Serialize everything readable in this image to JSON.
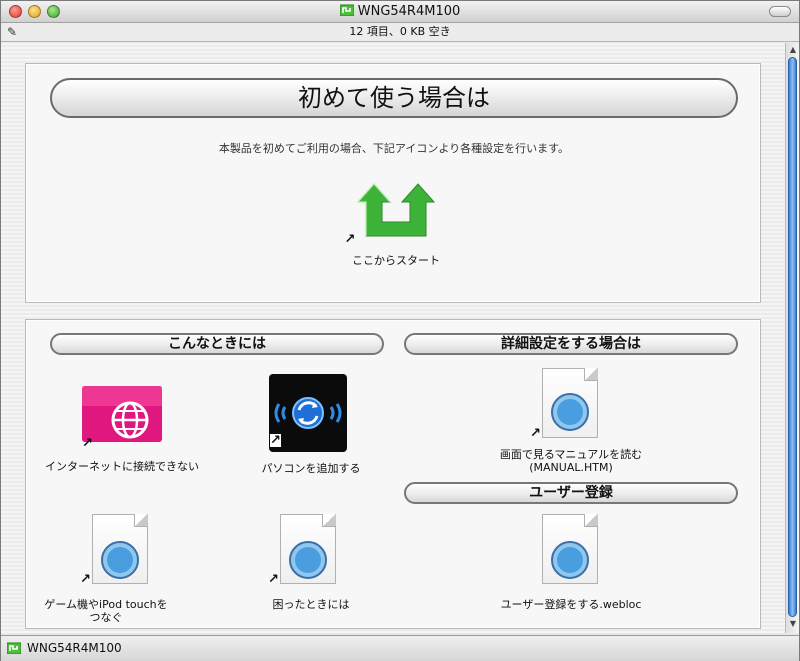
{
  "window": {
    "title": "WNG54R4M100",
    "status": "12 項目、0 KB 空き"
  },
  "top_panel": {
    "heading": "初めて使う場合は",
    "description": "本製品を初めてご利用の場合、下記アイコンより各種設定を行います。",
    "start_item": {
      "label": "ここからスタート",
      "icon": "green-arrow-start-icon"
    }
  },
  "left_section": {
    "heading": "こんなときには",
    "items": [
      {
        "label": "インターネットに接続できない",
        "icon": "pink-globe-icon"
      },
      {
        "label": "パソコンを追加する",
        "icon": "blue-sync-icon"
      },
      {
        "label": "ゲーム機やiPod touchをつなぐ",
        "icon": "safari-document-icon"
      },
      {
        "label": "困ったときには",
        "icon": "safari-document-icon"
      }
    ]
  },
  "right_section": {
    "heading_advanced": "詳細設定をする場合は",
    "manual_item": {
      "label_line1": "画面で見るマニュアルを読む",
      "label_line2": "(MANUAL.HTM)",
      "icon": "safari-document-icon"
    },
    "heading_register": "ユーザー登録",
    "register_item": {
      "label": "ユーザー登録をする.webloc",
      "icon": "safari-document-icon"
    }
  },
  "footer": {
    "path_label": "WNG54R4M100"
  },
  "colors": {
    "accent_green": "#3db33a",
    "accent_pink": "#e0177f",
    "scroll_blue": "#3a7bd5"
  }
}
